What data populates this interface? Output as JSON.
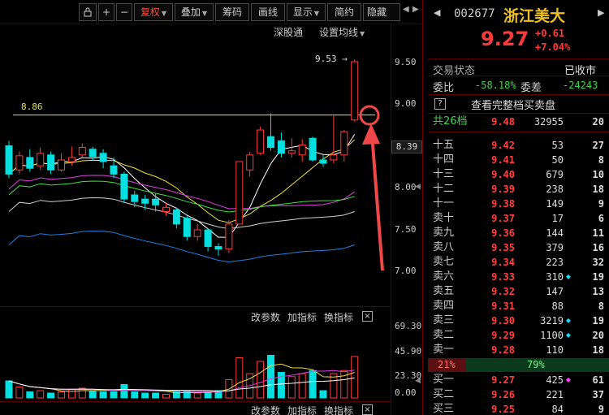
{
  "toolbar": {
    "lock_icon": "lock-icon",
    "plus": "+",
    "minus": "−",
    "fuquan": "复权",
    "diejia": "叠加",
    "chouma": "筹码",
    "huaxian": "画线",
    "xianshi": "显示",
    "jianyue": "简约",
    "yincang": "隐藏"
  },
  "subbar": {
    "shengutong": "深股通",
    "setting_ma": "设置均线"
  },
  "chart": {
    "high_marker": "9.53",
    "ref_line_label": "8.86",
    "current_tag": "8.39",
    "price_axis": [
      "9.50",
      "9.00",
      "8.50",
      "8.00",
      "7.50",
      "7.00"
    ]
  },
  "indicator_pane": {
    "change_param": "改参数",
    "add_indicator": "加指标",
    "swap_indicator": "换指标",
    "close": "×",
    "vol_axis": [
      "69.30",
      "45.90",
      "23.30",
      "0.00"
    ]
  },
  "bottom_pane": {
    "change_param": "改参数",
    "add_indicator": "加指标",
    "swap_indicator": "换指标",
    "close": "×"
  },
  "quote": {
    "code": "002677",
    "name": "浙江美大",
    "price": "9.27",
    "change": "+0.61",
    "change_pct": "+7.04%",
    "status_label": "交易状态",
    "status_value": "已收市",
    "weibi_label": "委比",
    "weibi_value": "-58.18%",
    "weicha_label": "委差",
    "weicha_value": "-24243",
    "full_book_icon": "?",
    "full_book_text": "查看完整档买卖盘",
    "total_label": "共26档",
    "total_price": "9.48",
    "total_vol": "32955",
    "total_count": "20"
  },
  "asks": [
    {
      "label": "十五",
      "price": "9.42",
      "vol": "53",
      "dot": "",
      "count": "27"
    },
    {
      "label": "十四",
      "price": "9.41",
      "vol": "50",
      "dot": "",
      "count": "8"
    },
    {
      "label": "十三",
      "price": "9.40",
      "vol": "679",
      "dot": "",
      "count": "10"
    },
    {
      "label": "十二",
      "price": "9.39",
      "vol": "238",
      "dot": "",
      "count": "18"
    },
    {
      "label": "十一",
      "price": "9.38",
      "vol": "149",
      "dot": "",
      "count": "9"
    },
    {
      "label": "卖十",
      "price": "9.37",
      "vol": "17",
      "dot": "",
      "count": "6"
    },
    {
      "label": "卖九",
      "price": "9.36",
      "vol": "144",
      "dot": "",
      "count": "11"
    },
    {
      "label": "卖八",
      "price": "9.35",
      "vol": "379",
      "dot": "",
      "count": "16"
    },
    {
      "label": "卖七",
      "price": "9.34",
      "vol": "223",
      "dot": "",
      "count": "32"
    },
    {
      "label": "卖六",
      "price": "9.33",
      "vol": "310",
      "dot": "cyan",
      "count": "19"
    },
    {
      "label": "卖五",
      "price": "9.32",
      "vol": "147",
      "dot": "",
      "count": "13"
    },
    {
      "label": "卖四",
      "price": "9.31",
      "vol": "88",
      "dot": "",
      "count": "8"
    },
    {
      "label": "卖三",
      "price": "9.30",
      "vol": "3219",
      "dot": "cyan",
      "count": "19"
    },
    {
      "label": "卖二",
      "price": "9.29",
      "vol": "1100",
      "dot": "cyan",
      "count": "20"
    },
    {
      "label": "卖一",
      "price": "9.28",
      "vol": "110",
      "dot": "",
      "count": "18"
    }
  ],
  "ratio_bar": {
    "left": "21%",
    "right": "79%",
    "left_fraction": 0.21
  },
  "bids": [
    {
      "label": "买一",
      "price": "9.27",
      "vol": "425",
      "dot": "magenta",
      "count": "61"
    },
    {
      "label": "买二",
      "price": "9.26",
      "vol": "221",
      "dot": "",
      "count": "37"
    },
    {
      "label": "买三",
      "price": "9.25",
      "vol": "84",
      "dot": "",
      "count": "9"
    }
  ],
  "candles": [
    {
      "o": 8.49,
      "c": 8.15,
      "h": 8.55,
      "l": 8.1
    },
    {
      "o": 8.2,
      "c": 8.37,
      "h": 8.42,
      "l": 8.15
    },
    {
      "o": 8.35,
      "c": 8.22,
      "h": 8.45,
      "l": 8.18
    },
    {
      "o": 8.25,
      "c": 8.4,
      "h": 8.47,
      "l": 8.2
    },
    {
      "o": 8.38,
      "c": 8.2,
      "h": 8.42,
      "l": 8.15
    },
    {
      "o": 8.2,
      "c": 8.32,
      "h": 8.4,
      "l": 8.18
    },
    {
      "o": 8.3,
      "c": 8.35,
      "h": 8.48,
      "l": 8.25
    },
    {
      "o": 8.38,
      "c": 8.47,
      "h": 8.52,
      "l": 8.35
    },
    {
      "o": 8.45,
      "c": 8.36,
      "h": 8.48,
      "l": 8.32
    },
    {
      "o": 8.4,
      "c": 8.3,
      "h": 8.45,
      "l": 8.22
    },
    {
      "o": 8.25,
      "c": 8.15,
      "h": 8.35,
      "l": 8.1
    },
    {
      "o": 8.15,
      "c": 7.85,
      "h": 8.18,
      "l": 7.8
    },
    {
      "o": 7.9,
      "c": 7.82,
      "h": 7.95,
      "l": 7.75
    },
    {
      "o": 7.85,
      "c": 7.8,
      "h": 7.9,
      "l": 7.72
    },
    {
      "o": 7.85,
      "c": 7.78,
      "h": 7.92,
      "l": 7.7
    },
    {
      "o": 7.7,
      "c": 7.75,
      "h": 7.8,
      "l": 7.65
    },
    {
      "o": 7.72,
      "c": 7.55,
      "h": 7.75,
      "l": 7.5
    },
    {
      "o": 7.62,
      "c": 7.4,
      "h": 7.65,
      "l": 7.35
    },
    {
      "o": 7.4,
      "c": 7.48,
      "h": 7.55,
      "l": 7.35
    },
    {
      "o": 7.48,
      "c": 7.28,
      "h": 7.5,
      "l": 7.22
    },
    {
      "o": 7.28,
      "c": 7.25,
      "h": 7.32,
      "l": 7.17
    },
    {
      "o": 7.25,
      "c": 7.55,
      "h": 7.6,
      "l": 7.2
    },
    {
      "o": 7.55,
      "c": 8.3,
      "h": 8.3,
      "l": 7.55
    },
    {
      "o": 8.2,
      "c": 8.38,
      "h": 8.42,
      "l": 8.12
    },
    {
      "o": 8.4,
      "c": 8.68,
      "h": 8.72,
      "l": 8.38
    },
    {
      "o": 8.6,
      "c": 8.47,
      "h": 8.88,
      "l": 8.43
    },
    {
      "o": 8.55,
      "c": 8.4,
      "h": 8.65,
      "l": 8.35
    },
    {
      "o": 8.4,
      "c": 8.43,
      "h": 8.58,
      "l": 8.35
    },
    {
      "o": 8.38,
      "c": 8.5,
      "h": 8.57,
      "l": 8.3
    },
    {
      "o": 8.58,
      "c": 8.32,
      "h": 8.6,
      "l": 8.3
    },
    {
      "o": 8.32,
      "c": 8.28,
      "h": 8.38,
      "l": 8.24
    },
    {
      "o": 8.32,
      "c": 8.38,
      "h": 8.85,
      "l": 8.28
    },
    {
      "o": 8.38,
      "c": 8.66,
      "h": 8.68,
      "l": 8.3
    },
    {
      "o": 8.8,
      "c": 9.5,
      "h": 9.53,
      "l": 8.78
    }
  ],
  "volumes": [
    {
      "v": 0.28,
      "up": false
    },
    {
      "v": 0.18,
      "up": true
    },
    {
      "v": 0.1,
      "up": false
    },
    {
      "v": 0.12,
      "up": true
    },
    {
      "v": 0.08,
      "up": false
    },
    {
      "v": 0.1,
      "up": true
    },
    {
      "v": 0.14,
      "up": true
    },
    {
      "v": 0.16,
      "up": true
    },
    {
      "v": 0.12,
      "up": false
    },
    {
      "v": 0.1,
      "up": false
    },
    {
      "v": 0.1,
      "up": false
    },
    {
      "v": 0.22,
      "up": false
    },
    {
      "v": 0.1,
      "up": false
    },
    {
      "v": 0.08,
      "up": false
    },
    {
      "v": 0.08,
      "up": false
    },
    {
      "v": 0.06,
      "up": true
    },
    {
      "v": 0.1,
      "up": false
    },
    {
      "v": 0.12,
      "up": false
    },
    {
      "v": 0.08,
      "up": true
    },
    {
      "v": 0.1,
      "up": false
    },
    {
      "v": 0.12,
      "up": false
    },
    {
      "v": 0.3,
      "up": true
    },
    {
      "v": 0.66,
      "up": true
    },
    {
      "v": 0.4,
      "up": true
    },
    {
      "v": 0.6,
      "up": true
    },
    {
      "v": 0.7,
      "up": false
    },
    {
      "v": 0.42,
      "up": false
    },
    {
      "v": 0.35,
      "up": true
    },
    {
      "v": 0.4,
      "up": true
    },
    {
      "v": 0.45,
      "up": false
    },
    {
      "v": 0.12,
      "up": false
    },
    {
      "v": 0.4,
      "up": true
    },
    {
      "v": 0.45,
      "up": true
    },
    {
      "v": 0.68,
      "up": true
    }
  ],
  "colors": {
    "up": "#ff3a3a",
    "down": "#00e0e0",
    "accent_orange": "#f0a000",
    "ref_line": "#e0e060",
    "annotation_red": "#f04848",
    "ma5": "#ffffff",
    "ma10": "#f0e040",
    "ma20": "#e040e0",
    "ma30": "#40e040",
    "ma60": "#d0d0d0",
    "ma120": "#2080e0"
  }
}
